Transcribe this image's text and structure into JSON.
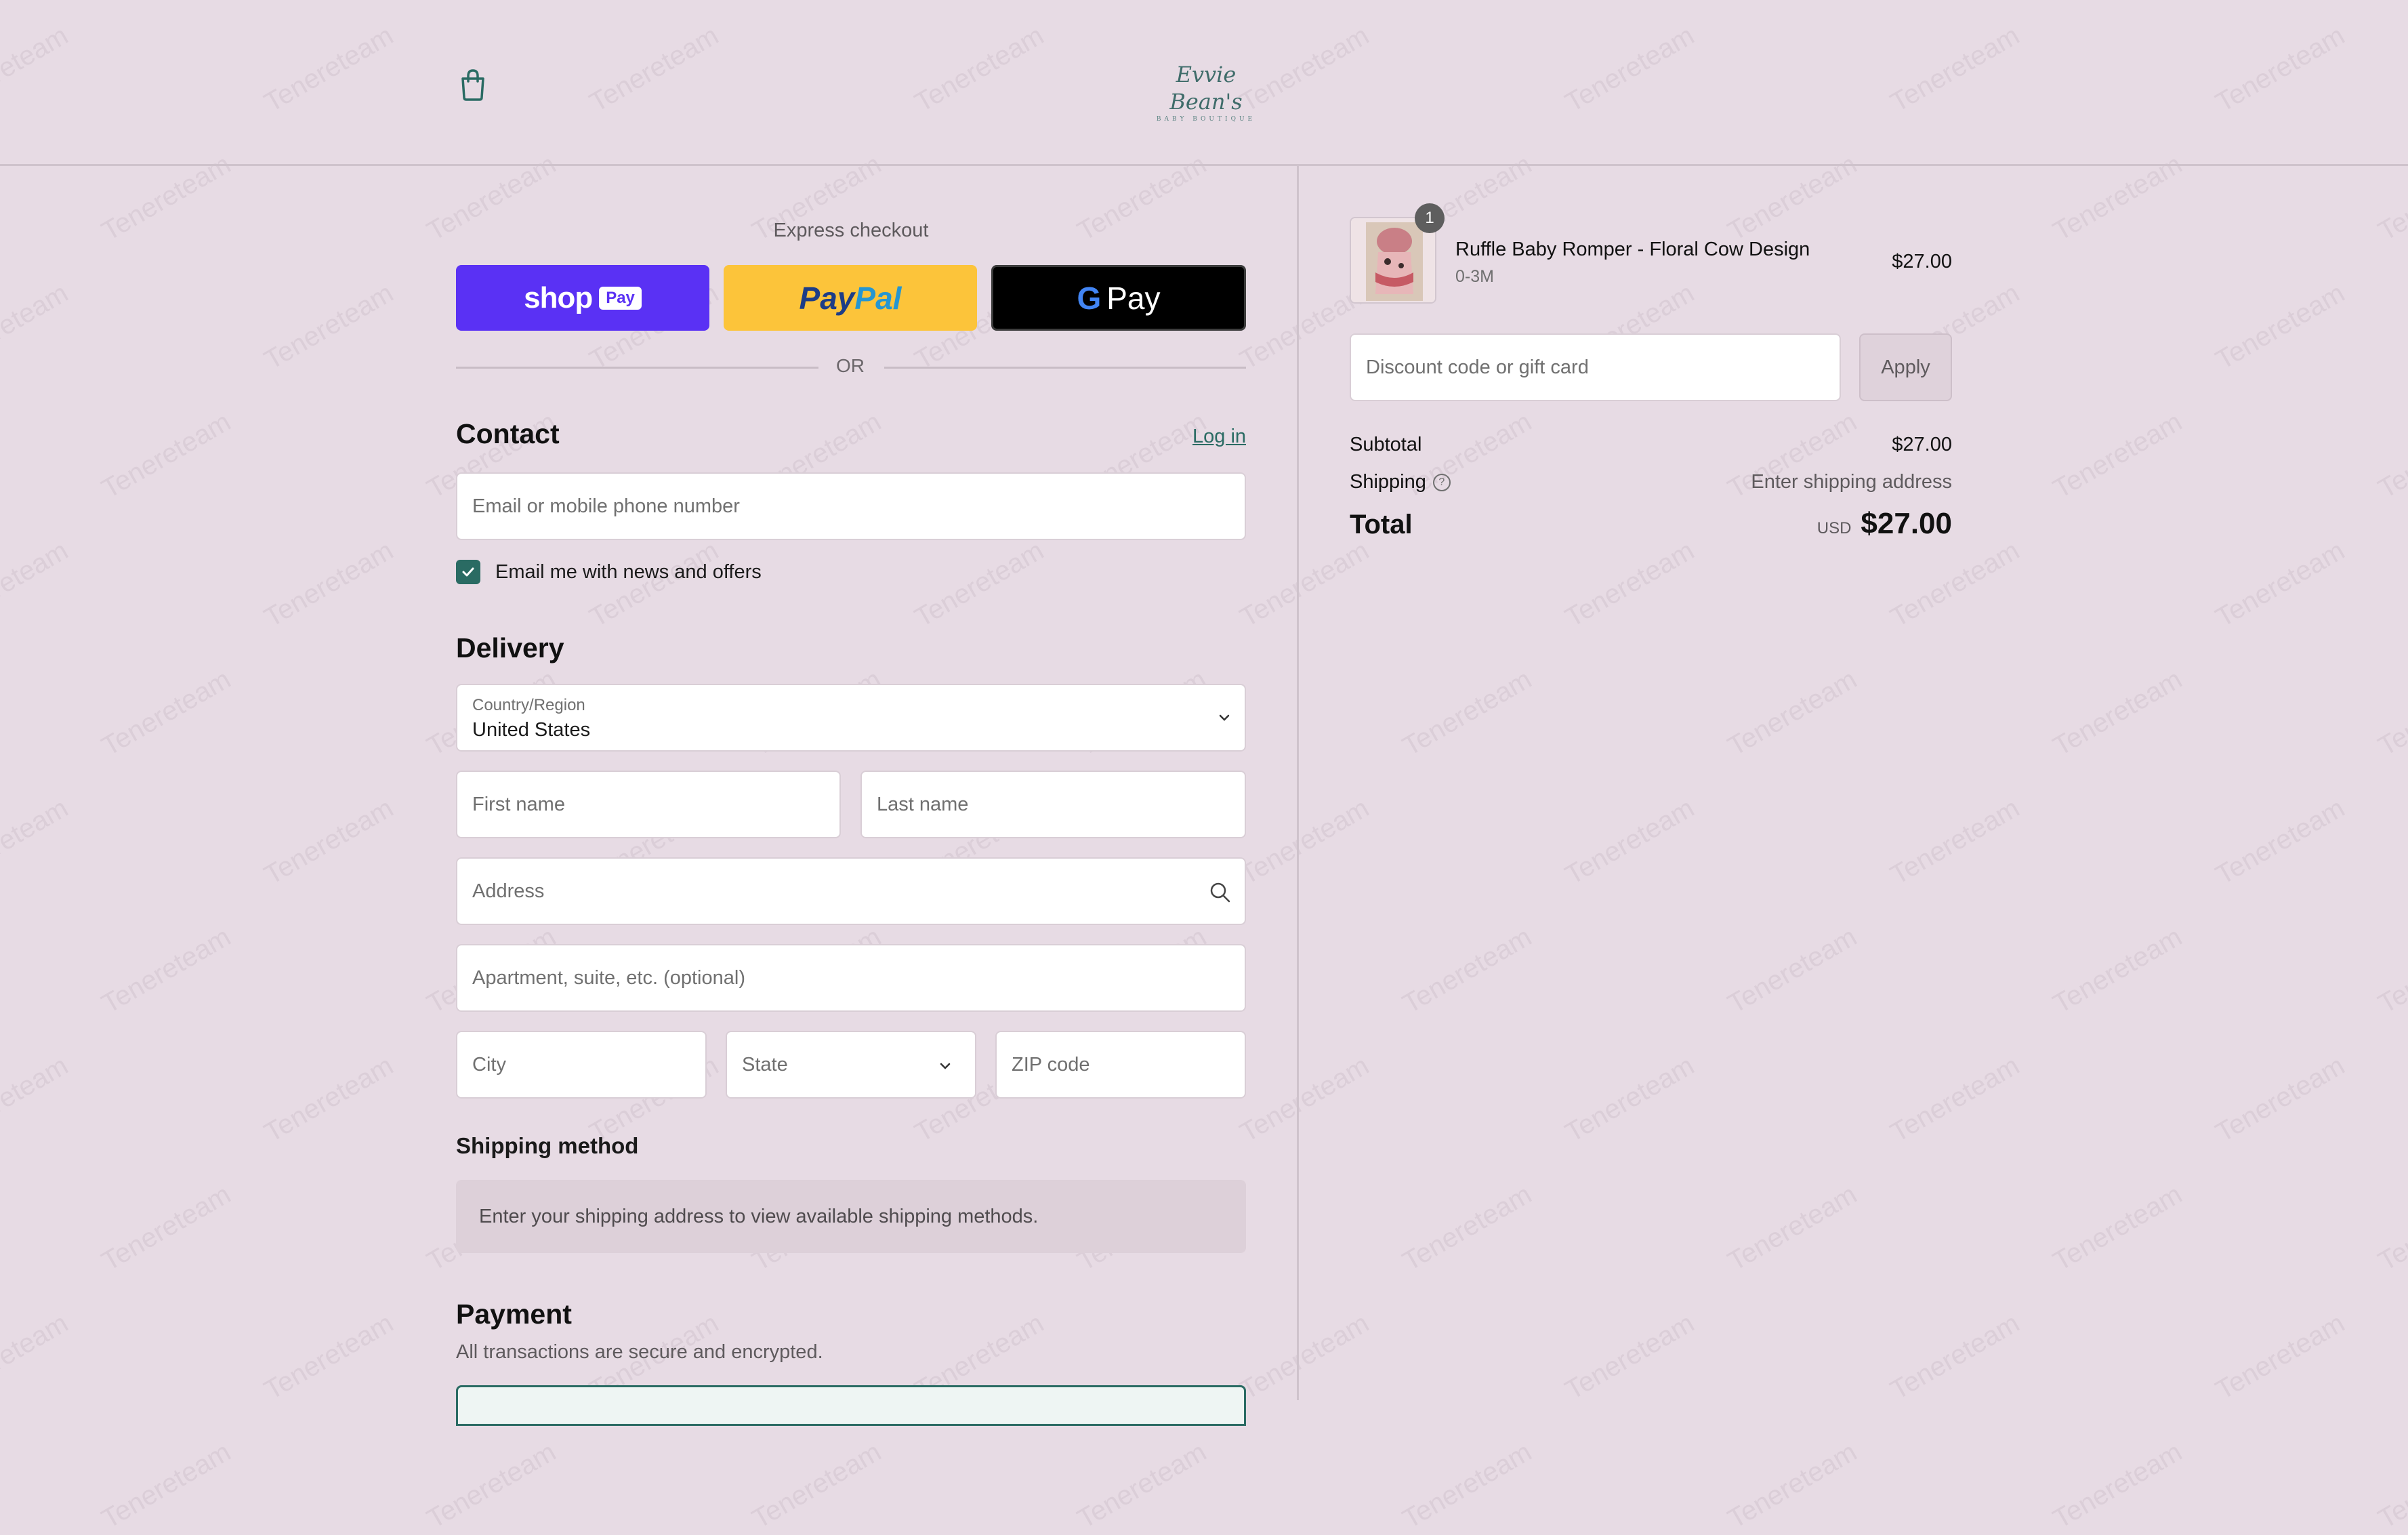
{
  "header": {
    "logo_main": "Evvie Bean's",
    "logo_sub": "BABY BOUTIQUE",
    "cart_icon": "shopping-bag-icon"
  },
  "express": {
    "title": "Express checkout",
    "shop_pay": {
      "word": "shop",
      "pill": "Pay"
    },
    "paypal": {
      "part1": "Pay",
      "part2": "Pal"
    },
    "gpay": {
      "g": "G",
      "word": "Pay"
    },
    "or": "OR"
  },
  "contact": {
    "title": "Contact",
    "login": "Log in",
    "email_placeholder": "Email or mobile phone number",
    "newsletter_label": "Email me with news and offers",
    "newsletter_checked": true
  },
  "delivery": {
    "title": "Delivery",
    "country_label": "Country/Region",
    "country_value": "United States",
    "first_name": "First name",
    "last_name": "Last name",
    "address": "Address",
    "apartment": "Apartment, suite, etc. (optional)",
    "city": "City",
    "state": "State",
    "zip": "ZIP code"
  },
  "shipping_method": {
    "title": "Shipping method",
    "notice": "Enter your shipping address to view available shipping methods."
  },
  "payment": {
    "title": "Payment",
    "subtitle": "All transactions are secure and encrypted."
  },
  "order": {
    "item": {
      "name": "Ruffle Baby Romper - Floral Cow Design",
      "variant": "0-3M",
      "price": "$27.00",
      "quantity": "1"
    },
    "discount_placeholder": "Discount code or gift card",
    "apply": "Apply",
    "subtotal_label": "Subtotal",
    "subtotal_value": "$27.00",
    "shipping_label": "Shipping",
    "shipping_value": "Enter shipping address",
    "total_label": "Total",
    "total_currency": "USD",
    "total_value": "$27.00"
  },
  "watermark": "Tenereteam",
  "colors": {
    "background": "#e7dbe4",
    "accent": "#2a6b63",
    "shop_pay": "#5a31f4",
    "paypal": "#fcc43a"
  }
}
